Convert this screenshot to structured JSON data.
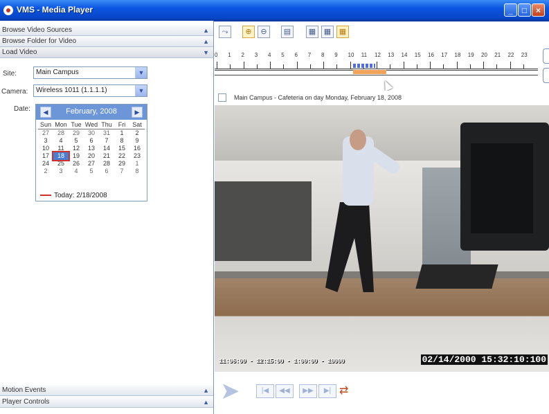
{
  "window": {
    "title": "VMS - Media Player",
    "minimize": "_",
    "maximize": "□",
    "close": "×"
  },
  "left_panel": {
    "browse_cameras": "Browse Video Sources",
    "browse_folder": "Browse Folder for Video",
    "load_video": "Load Video",
    "site_label": "Site:",
    "site_value": "Main Campus",
    "camera_label": "Camera:",
    "camera_value": "Wireless 1011 (1.1.1.1)",
    "date_label": "Date:",
    "motion_events": "Motion Events",
    "player_controls": "Player Controls",
    "collapse_arrow": "▲",
    "expand_arrow": "▼"
  },
  "calendar": {
    "month": "February, 2008",
    "prev": "◀",
    "next": "▶",
    "weekdays": [
      "Sun",
      "Mon",
      "Tue",
      "Wed",
      "Thu",
      "Fri",
      "Sat"
    ],
    "weeks": [
      [
        "27",
        "28",
        "29",
        "30",
        "31",
        "1",
        "2"
      ],
      [
        "3",
        "4",
        "5",
        "6",
        "7",
        "8",
        "9"
      ],
      [
        "10",
        "11",
        "12",
        "13",
        "14",
        "15",
        "16"
      ],
      [
        "17",
        "18",
        "19",
        "20",
        "21",
        "22",
        "23"
      ],
      [
        "24",
        "25",
        "26",
        "27",
        "28",
        "29",
        "1"
      ],
      [
        "2",
        "3",
        "4",
        "5",
        "6",
        "7",
        "8"
      ]
    ],
    "selected": "18",
    "today": "Today: 2/18/2008"
  },
  "timeline": {
    "hours": [
      "0",
      "1",
      "2",
      "3",
      "4",
      "5",
      "6",
      "7",
      "8",
      "9",
      "10",
      "11",
      "12",
      "13",
      "14",
      "15",
      "16",
      "17",
      "18",
      "19",
      "20",
      "21",
      "22",
      "23"
    ]
  },
  "video": {
    "caption": "Main Campus - Cafeteria on day Monday, February 18, 2008",
    "osd_left": "11:06:00 - 12:15:00 - 1:00:00 - 10000",
    "osd_right": "02/14/2000 15:32:10:100"
  },
  "colors": {
    "titlebar": "#0a55e0",
    "calendar_header": "#6d96d8",
    "timeline_recorded": "#f2a35a",
    "timeline_motion": "#4f6fd6",
    "today_marker": "#d2302c"
  }
}
